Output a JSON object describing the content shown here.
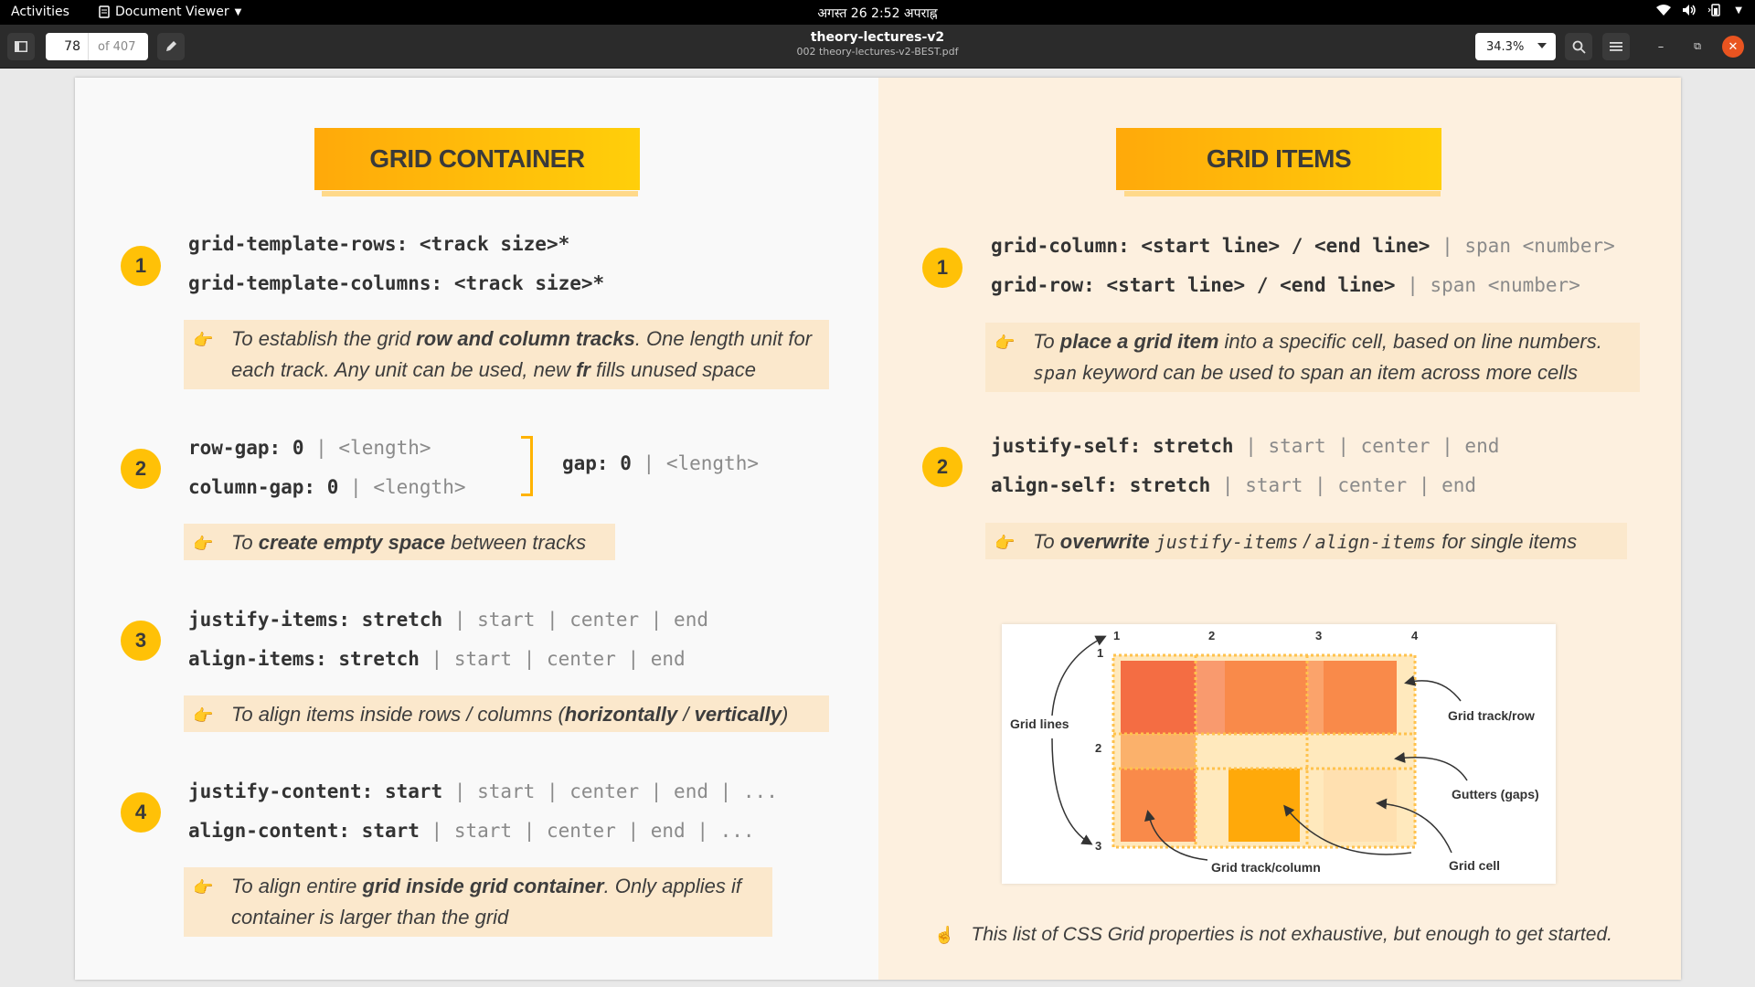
{
  "topbar": {
    "activities": "Activities",
    "app_name": "Document Viewer",
    "clock": "अगस्त 26  2:52 अपराह्न"
  },
  "toolbar": {
    "current_page": "78",
    "page_of": "of 407",
    "doc_title": "theory-lectures-v2",
    "doc_subtitle": "002 theory-lectures-v2-BEST.pdf",
    "zoom": "34.3%"
  },
  "icons": {
    "sidebar_toggle": "sidebar-icon",
    "annotate": "pencil-icon",
    "search": "search-icon",
    "menu": "hamburger-icon",
    "minimize": "minimize-icon",
    "restore": "restore-icon",
    "close": "close-icon",
    "tray": [
      "wifi-icon",
      "volume-icon",
      "battery-icon",
      "power-menu-icon"
    ]
  },
  "colors": {
    "accent_orange": "#ffc107",
    "close_button": "#e95420"
  },
  "slide": {
    "left": {
      "heading": "GRID CONTAINER",
      "sections": [
        {
          "number": "1",
          "lines": [
            {
              "key": "grid-template-rows:",
              "value": "<track size>*",
              "alt": ""
            },
            {
              "key": "grid-template-columns:",
              "value": "<track size>*",
              "alt": ""
            }
          ],
          "note": {
            "pre": "To establish the grid ",
            "b1": "row and column tracks",
            "mid": ". One length unit for each track. Any unit can be used, new ",
            "b2": "fr",
            "post": " fills unused space"
          }
        },
        {
          "number": "2",
          "lines": [
            {
              "key": "row-gap:",
              "value": "0",
              "alt": "| <length>"
            },
            {
              "key": "column-gap:",
              "value": "0",
              "alt": "| <length>"
            }
          ],
          "gap_line": {
            "key": "gap:",
            "value": "0",
            "alt": "| <length>"
          },
          "note": {
            "pre": "To ",
            "b1": "create empty space",
            "post": " between tracks"
          }
        },
        {
          "number": "3",
          "lines": [
            {
              "key": "justify-items:",
              "value": "stretch",
              "alt": "| start | center | end"
            },
            {
              "key": "align-items:",
              "value": "stretch",
              "alt": "| start | center | end"
            }
          ],
          "note": {
            "pre": "To align items inside rows / columns (",
            "b1": "horizontally",
            "mid": " / ",
            "b2": "vertically",
            "post": ")"
          }
        },
        {
          "number": "4",
          "lines": [
            {
              "key": "justify-content:",
              "value": "start",
              "alt": "| start | center | end | ..."
            },
            {
              "key": "align-content:",
              "value": "start",
              "alt": "| start | center | end | ..."
            }
          ],
          "note": {
            "pre": "To align entire ",
            "b1": "grid inside grid container",
            "post": ". Only applies if container is larger than the grid"
          }
        }
      ]
    },
    "right": {
      "heading": "GRID ITEMS",
      "sections": [
        {
          "number": "1",
          "lines": [
            {
              "key": "grid-column:",
              "value": "<start line> / <end line>",
              "alt": "| span <number>"
            },
            {
              "key": "grid-row:",
              "value": "<start line> / <end line>",
              "alt": "| span <number>"
            }
          ],
          "note": {
            "pre": "To ",
            "b1": "place a grid item",
            "mid": " into a specific cell, based on line numbers. ",
            "mono": "span",
            "post": " keyword can be used to span an item across more cells"
          }
        },
        {
          "number": "2",
          "lines": [
            {
              "key": "justify-self:",
              "value": "stretch",
              "alt": "| start | center | end"
            },
            {
              "key": "align-self:",
              "value": "stretch",
              "alt": "| start | center | end"
            }
          ],
          "note": {
            "pre": "To ",
            "b1": "overwrite",
            "mono1": "justify-items",
            "sep": " / ",
            "mono2": "align-items",
            "post": " for single items"
          }
        }
      ],
      "diagram": {
        "col_numbers": [
          "1",
          "2",
          "3",
          "4"
        ],
        "row_numbers": [
          "1",
          "2",
          "3"
        ],
        "labels": {
          "grid_lines": "Grid lines",
          "grid_track_row": "Grid track/row",
          "gutters": "Gutters (gaps)",
          "grid_cell": "Grid cell",
          "grid_track_column": "Grid track/column"
        }
      },
      "footnote": "This list of CSS Grid properties is not exhaustive, but enough to get started."
    }
  }
}
